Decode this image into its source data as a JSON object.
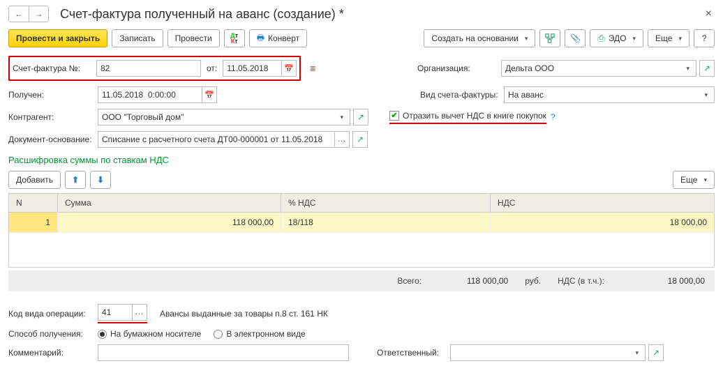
{
  "page": {
    "title": "Счет-фактура полученный на аванс (создание) *"
  },
  "toolbar": {
    "post_close": "Провести и закрыть",
    "save": "Записать",
    "post": "Провести",
    "convert": "Конверт",
    "create_based": "Создать на основании",
    "edo": "ЭДО",
    "more": "Еще",
    "help": "?"
  },
  "header": {
    "number_label": "Счет-фактура №:",
    "number": "82",
    "date_label": "от:",
    "date": "11.05.2018",
    "org_label": "Организация:",
    "org": "Дельта ООО",
    "received_label": "Получен:",
    "received": "11.05.2018  0:00:00",
    "invoice_type_label": "Вид счета-фактуры:",
    "invoice_type": "На аванс",
    "counterparty_label": "Контрагент:",
    "counterparty": "ООО \"Торговый дом\"",
    "vat_deduct_check": "Отразить вычет НДС в книге покупок",
    "basis_label": "Документ-основание:",
    "basis": "Списание с расчетного счета ДТ00-000001 от 11.05.2018"
  },
  "vat_section": {
    "title": "Расшифровка суммы по ставкам НДС",
    "add": "Добавить",
    "more": "Еще",
    "columns": {
      "n": "N",
      "sum": "Сумма",
      "rate": "% НДС",
      "vat": "НДС"
    },
    "rows": [
      {
        "n": "1",
        "sum": "118 000,00",
        "rate": "18/118",
        "vat": "18 000,00"
      }
    ],
    "totals": {
      "total_label": "Всего:",
      "total": "118 000,00",
      "currency": "руб.",
      "vat_label": "НДС (в т.ч.):",
      "vat": "18 000,00"
    }
  },
  "footer": {
    "op_code_label": "Код вида операции:",
    "op_code": "41",
    "op_code_desc": "Авансы выданные за товары п.8 ст. 161 НК",
    "receipt_method_label": "Способ получения:",
    "receipt_paper": "На бумажном носителе",
    "receipt_electronic": "В электронном виде",
    "comment_label": "Комментарий:",
    "comment": "",
    "responsible_label": "Ответственный:",
    "responsible": ""
  }
}
